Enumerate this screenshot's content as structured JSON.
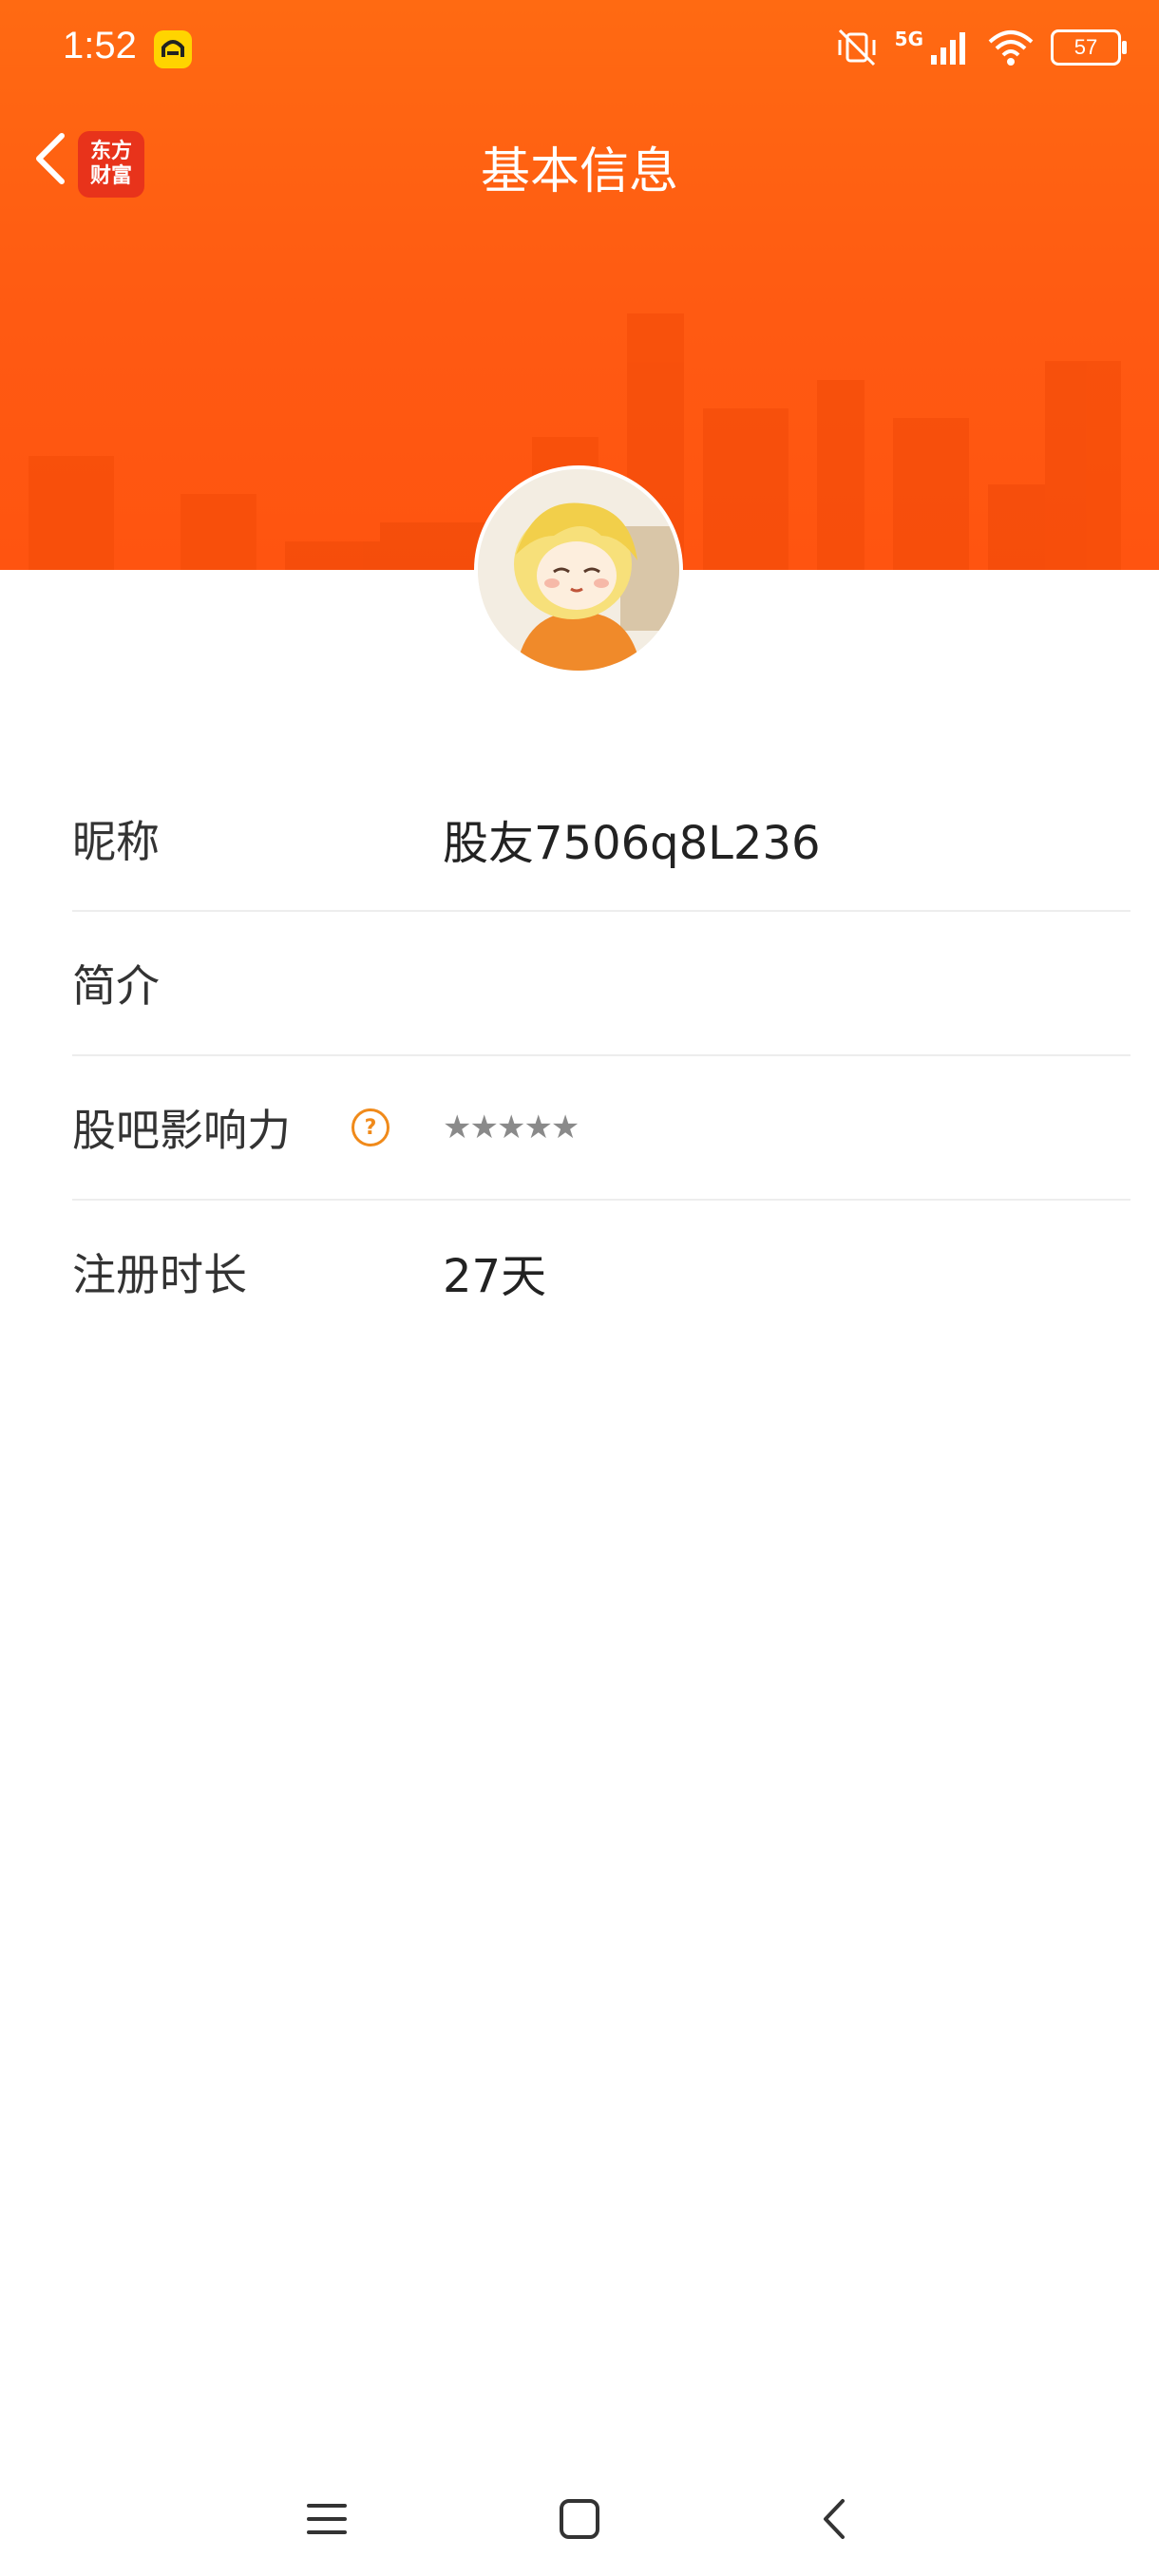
{
  "status_bar": {
    "time": "1:52",
    "network": "5G",
    "battery": "57"
  },
  "nav": {
    "title": "基本信息",
    "brand_line1": "东方",
    "brand_line2": "财富"
  },
  "profile": {
    "rows": [
      {
        "label": "昵称",
        "value": "股友7506q8L236"
      },
      {
        "label": "简介",
        "value": ""
      },
      {
        "label": "股吧影响力",
        "help": "?",
        "stars": "★★★★★",
        "rating": 0
      },
      {
        "label": "注册时长",
        "value": "27天"
      }
    ]
  },
  "colors": {
    "header_orange": "#ff5a12",
    "brand_red": "#e8331b",
    "help_orange": "#f08a1a"
  }
}
